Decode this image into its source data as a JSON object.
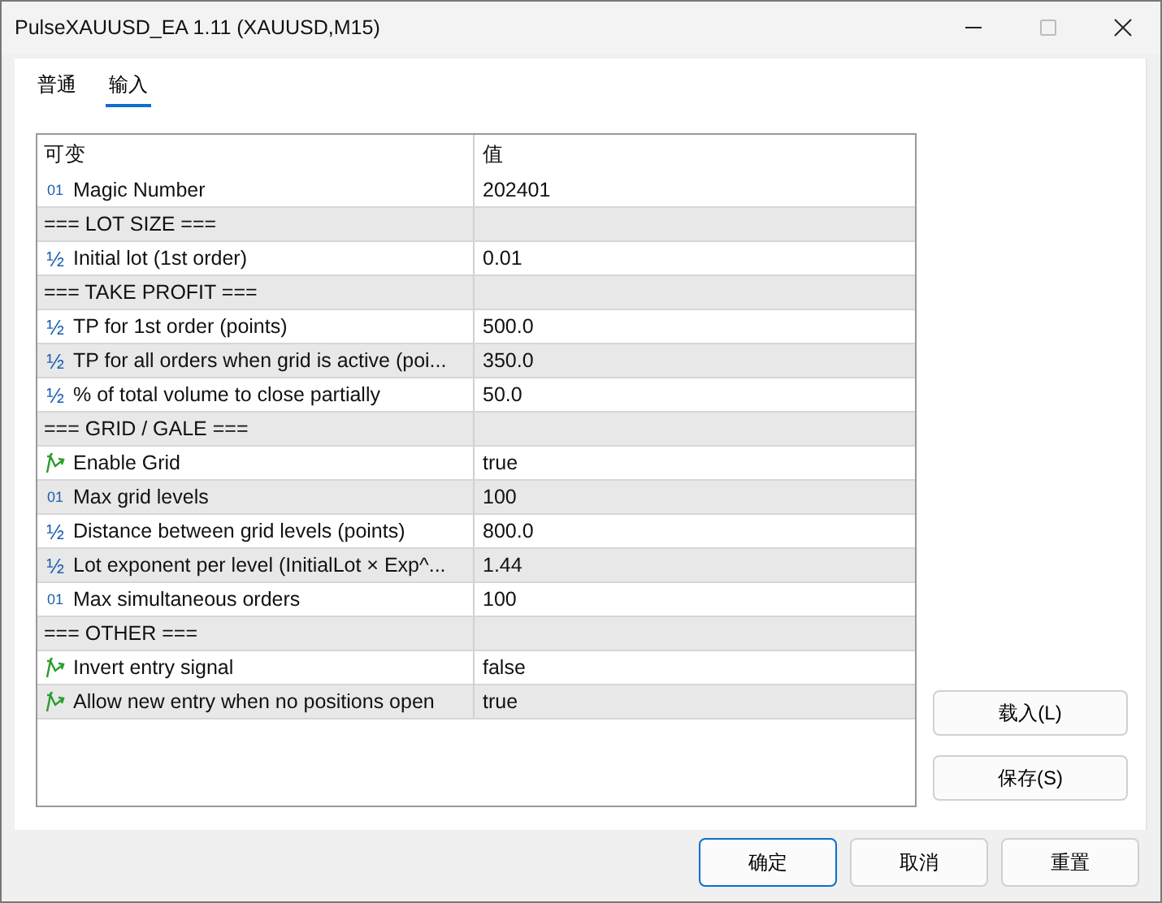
{
  "window": {
    "title": "PulseXAUUSD_EA 1.11 (XAUUSD,M15)"
  },
  "tabs": [
    {
      "label": "普通",
      "selected": false
    },
    {
      "label": "输入",
      "selected": true
    }
  ],
  "table": {
    "columns": [
      "可变",
      "值"
    ],
    "rows": [
      {
        "kind": "int",
        "mark": "01",
        "name": "Magic Number",
        "value": "202401"
      },
      {
        "kind": "section",
        "name": "=== LOT SIZE ==="
      },
      {
        "kind": "double",
        "mark": "½",
        "name": "Initial lot (1st order)",
        "value": "0.01"
      },
      {
        "kind": "section",
        "name": "=== TAKE PROFIT ==="
      },
      {
        "kind": "double",
        "mark": "½",
        "name": "TP for 1st order (points)",
        "value": "500.0"
      },
      {
        "kind": "double",
        "mark": "½",
        "name": "TP for all orders when grid is active (poi...",
        "value": "350.0"
      },
      {
        "kind": "double",
        "mark": "½",
        "name": "% of total volume to close partially",
        "value": "50.0"
      },
      {
        "kind": "section",
        "name": "=== GRID / GALE ==="
      },
      {
        "kind": "bool",
        "name": "Enable Grid",
        "value": "true"
      },
      {
        "kind": "int",
        "mark": "01",
        "name": "Max grid levels",
        "value": "100"
      },
      {
        "kind": "double",
        "mark": "½",
        "name": "Distance between grid levels (points)",
        "value": "800.0"
      },
      {
        "kind": "double",
        "mark": "½",
        "name": "Lot exponent per level (InitialLot × Exp^...",
        "value": "1.44"
      },
      {
        "kind": "int",
        "mark": "01",
        "name": "Max simultaneous orders",
        "value": "100"
      },
      {
        "kind": "section",
        "name": "=== OTHER ==="
      },
      {
        "kind": "bool",
        "name": "Invert entry signal",
        "value": "false"
      },
      {
        "kind": "bool",
        "name": "Allow new entry when no positions open",
        "value": "true"
      }
    ]
  },
  "side_buttons": [
    "载入(L)",
    "保存(S)"
  ],
  "buttons": [
    {
      "label": "确定",
      "default": true
    },
    {
      "label": "取消",
      "default": false
    },
    {
      "label": "重置",
      "default": false
    }
  ]
}
